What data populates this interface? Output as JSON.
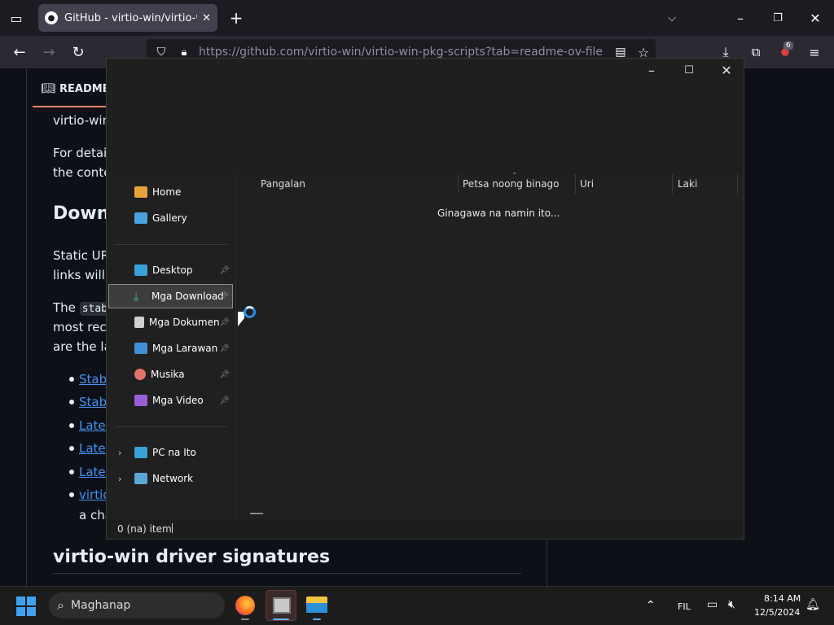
{
  "browser": {
    "tab_title": "GitHub - virtio-win/virtio-win-pkg-scripts",
    "url": "https://github.com/virtio-win/virtio-win-pkg-scripts?tab=readme-ov-file",
    "ext_badge": "6"
  },
  "github": {
    "readme_tab": "README",
    "line1": "virtio-win",
    "line2": "For detail",
    "line3": "the conte",
    "heading_download": "Down",
    "line4": "Static UR",
    "line5": "links will",
    "line6_prefix": "The",
    "line6_code": "stab",
    "line7": "most rece",
    "line8": "are the la",
    "links": [
      "Stabl",
      "Stabl",
      "Lates",
      "Lates",
      "Lates",
      "virtic"
    ],
    "continuation": "a cha",
    "heading_signatures": "virtio-win driver signatures"
  },
  "explorer": {
    "nav": {
      "home": "Home",
      "gallery": "Gallery",
      "desktop": "Desktop",
      "downloads": "Mga Download",
      "documents": "Mga Dokumento",
      "pictures": "Mga Larawan",
      "music": "Musika",
      "videos": "Mga Video",
      "this_pc": "PC na Ito",
      "network": "Network"
    },
    "columns": {
      "name": "Pangalan",
      "date": "Petsa noong binago",
      "type": "Uri",
      "size": "Laki"
    },
    "working_text": "Ginagawa na namin ito...",
    "status_text": "0 (na) item"
  },
  "taskbar": {
    "search_placeholder": "Maghanap",
    "language": "FIL",
    "time": "8:14 AM",
    "date": "12/5/2024"
  }
}
